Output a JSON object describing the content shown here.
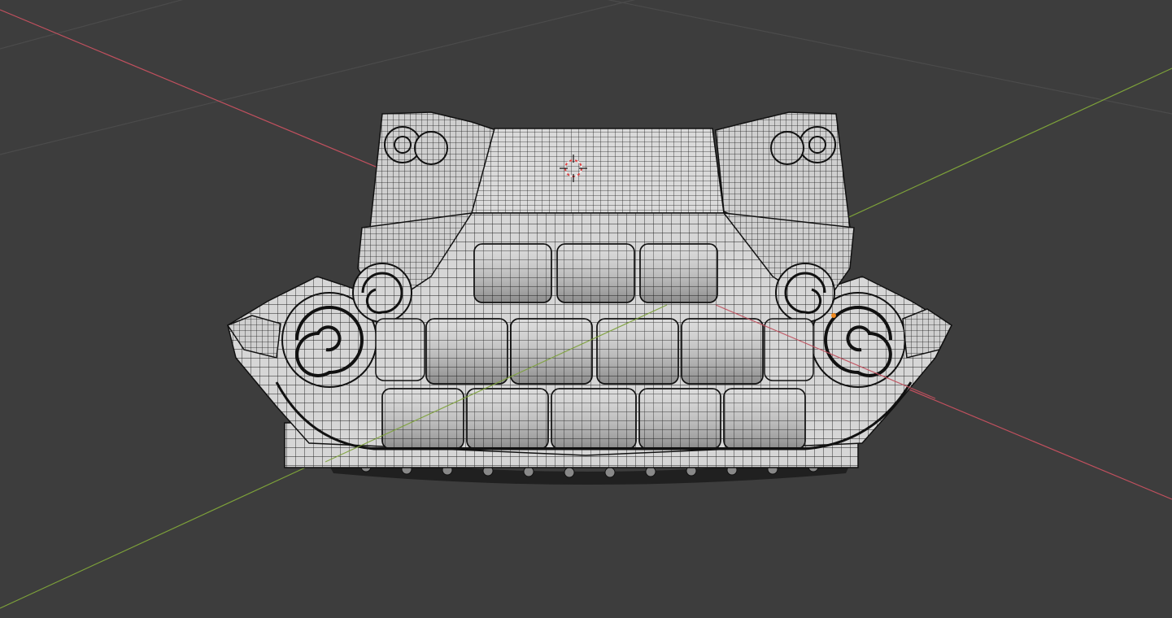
{
  "viewport": {
    "background": "#3d3d3d",
    "grid_color": "#4a4a4a",
    "x_axis_color": "#c0505e",
    "y_axis_color": "#7da13a"
  },
  "scene": {
    "object": "decorative-roof-ridge-mesh",
    "shading": "solid",
    "wireframe_overlay": true,
    "mesh_color": "#d4d4d4",
    "wire_color": "#1a1a1a",
    "selected_vertex_color": "#f08a20"
  },
  "cursor_3d": {
    "ring_colors": [
      "#e04040",
      "#f0f0f0"
    ]
  }
}
